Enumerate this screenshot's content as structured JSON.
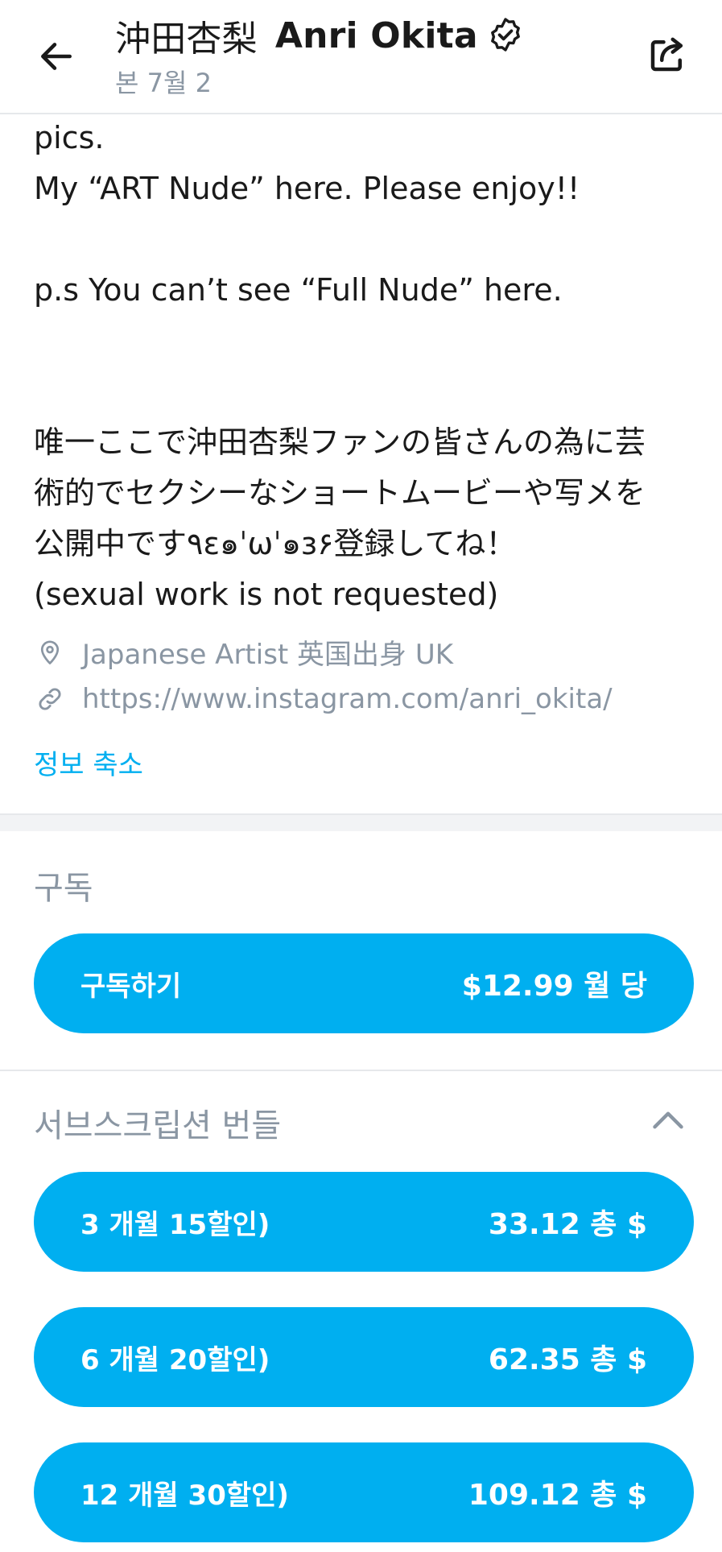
{
  "header": {
    "title_jp": "沖田杏梨",
    "title_en": "Anri Okita",
    "subtitle": "본  7월 2"
  },
  "bio": {
    "line1": "pics.",
    "line2": "My “ART Nude” here. Please enjoy!!",
    "line3": "p.s You can’t see “Full Nude” here.",
    "jp_line1": "唯一ここで沖田杏梨ファンの皆さんの為に芸",
    "jp_line2": "術的でセクシーなショートムービーや写メを",
    "jp_line3": "公開中です٩ɛ๑ˈωˈ๑ɜ۶登録してね！",
    "line4": "(sexual work is not requested)",
    "location": "Japanese Artist 英国出身 UK",
    "link": "https://www.instagram.com/anri_okita/",
    "collapse_label": "정보 축소"
  },
  "subscription": {
    "section_label": "구독",
    "button_label": "구독하기",
    "button_price": "$12.99 월 당"
  },
  "bundles": {
    "section_label": "서브스크립션 번들",
    "items": [
      {
        "label": "3 개월 15할인)",
        "price": "33.12 총 $"
      },
      {
        "label": "6 개월 20할인)",
        "price": "62.35 총 $"
      },
      {
        "label": "12 개월 30할인)",
        "price": "109.12 총 $"
      }
    ]
  },
  "colors": {
    "accent": "#00aff0",
    "muted": "#8a96a3"
  },
  "icons": {
    "back": "arrow-left-icon",
    "verified": "verified-badge-icon",
    "share": "share-icon",
    "location": "map-pin-icon",
    "link": "link-icon",
    "collapse": "chevron-up-icon"
  }
}
